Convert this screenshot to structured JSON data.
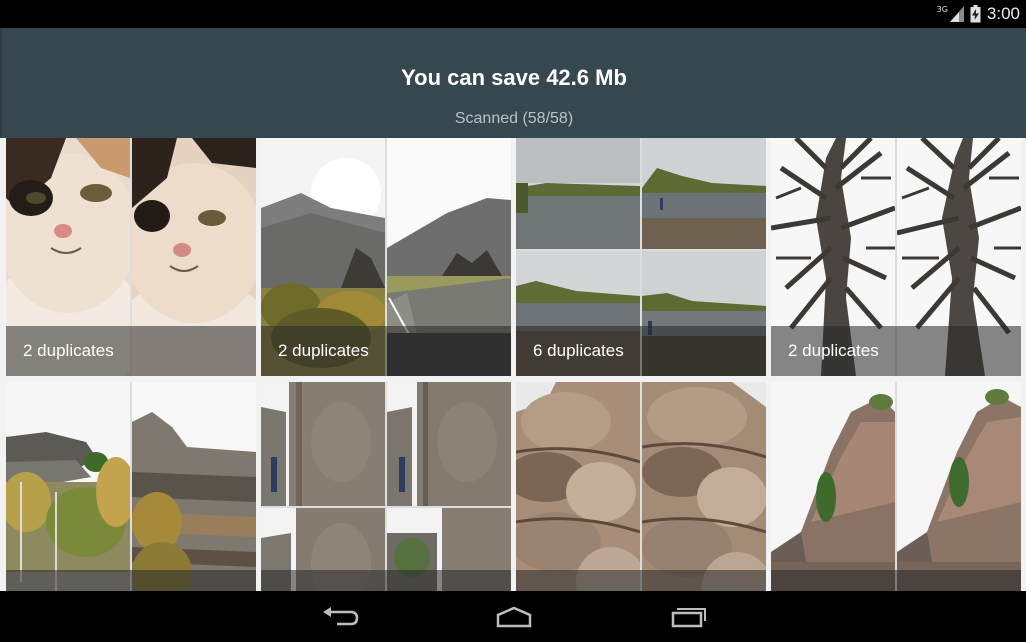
{
  "status_bar": {
    "network": "3G",
    "time": "3:00"
  },
  "header": {
    "title": "You can save 42.6 Mb",
    "subtitle": "Scanned (58/58)"
  },
  "cards": [
    {
      "label": "2 duplicates"
    },
    {
      "label": "2 duplicates"
    },
    {
      "label": "6 duplicates"
    },
    {
      "label": "2 duplicates"
    },
    {
      "label": ""
    },
    {
      "label": ""
    },
    {
      "label": ""
    },
    {
      "label": ""
    }
  ],
  "nav_bar": {
    "back": "back-icon",
    "home": "home-icon",
    "recents": "recents-icon"
  },
  "colors": {
    "header_bg": "#37474f",
    "overlay": "rgba(40,40,40,0.55)"
  }
}
